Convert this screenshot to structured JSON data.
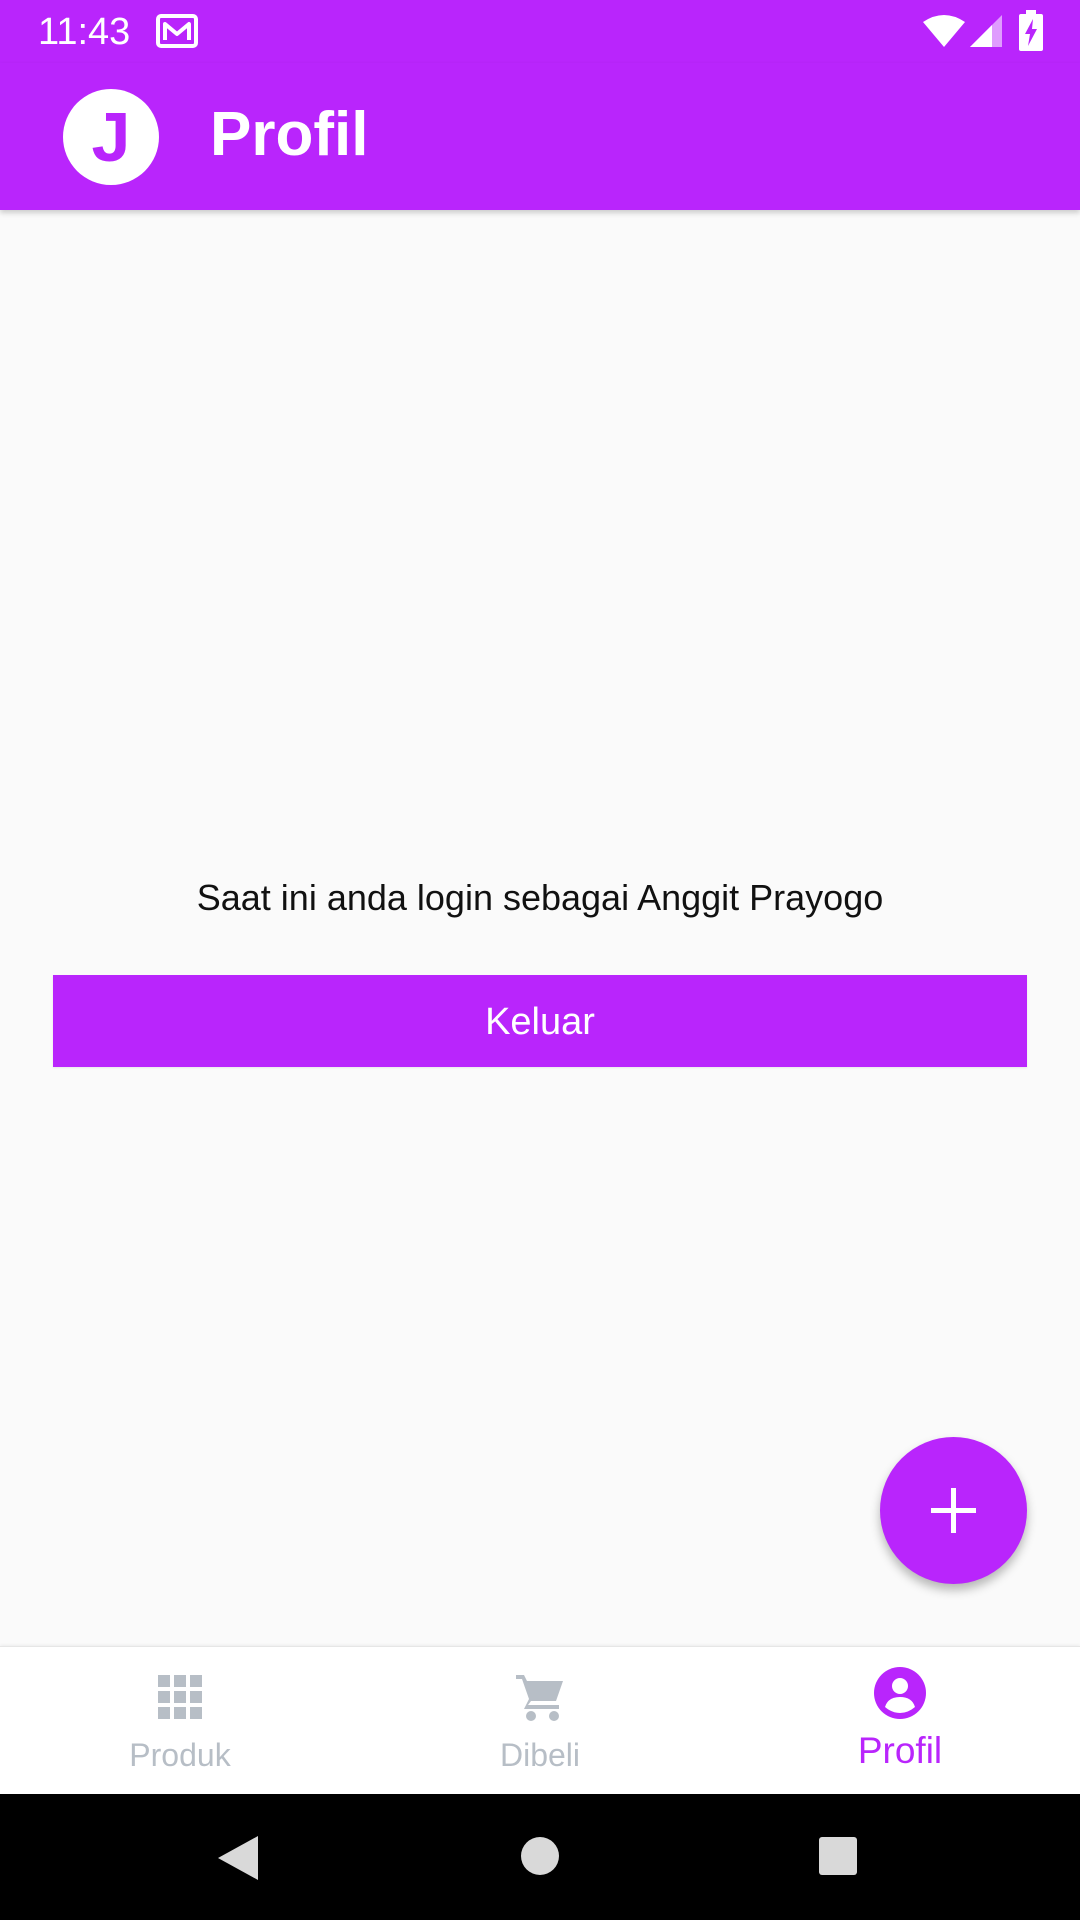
{
  "colors": {
    "primary": "#b925fc",
    "background": "#fafafa",
    "inactive_nav": "#b7bec6",
    "text": "#111111"
  },
  "status_bar": {
    "time": "11:43",
    "icons": [
      "mail-icon",
      "wifi-icon",
      "signal-icon",
      "battery-charging-icon"
    ]
  },
  "app_bar": {
    "avatar_letter": "J",
    "title": "Profil"
  },
  "main": {
    "login_message": "Saat ini anda login sebagai Anggit Prayogo",
    "logout_label": "Keluar"
  },
  "fab": {
    "icon": "plus-icon"
  },
  "bottom_nav": {
    "items": [
      {
        "label": "Produk",
        "icon": "grid-icon",
        "active": false
      },
      {
        "label": "Dibeli",
        "icon": "cart-icon",
        "active": false
      },
      {
        "label": "Profil",
        "icon": "account-icon",
        "active": true
      }
    ]
  },
  "system_nav": {
    "icons": [
      "back-icon",
      "home-icon",
      "recents-icon"
    ]
  }
}
